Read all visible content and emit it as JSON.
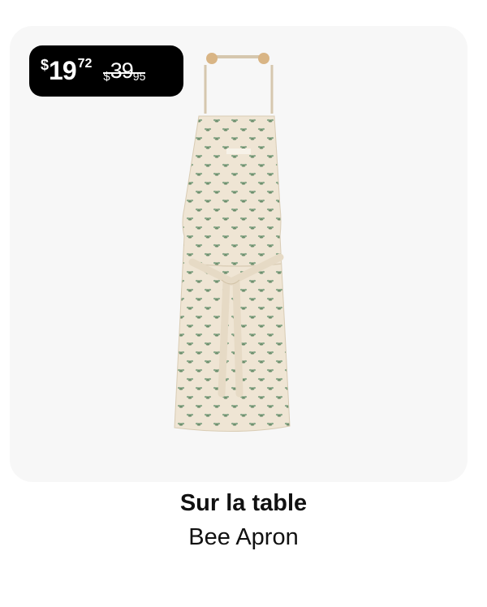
{
  "price": {
    "currency": "$",
    "current_whole": "19",
    "current_cents": "72",
    "original_whole": "39",
    "original_cents": "95"
  },
  "product": {
    "brand": "Sur la table",
    "name": "Bee Apron",
    "image": "apron-image"
  }
}
